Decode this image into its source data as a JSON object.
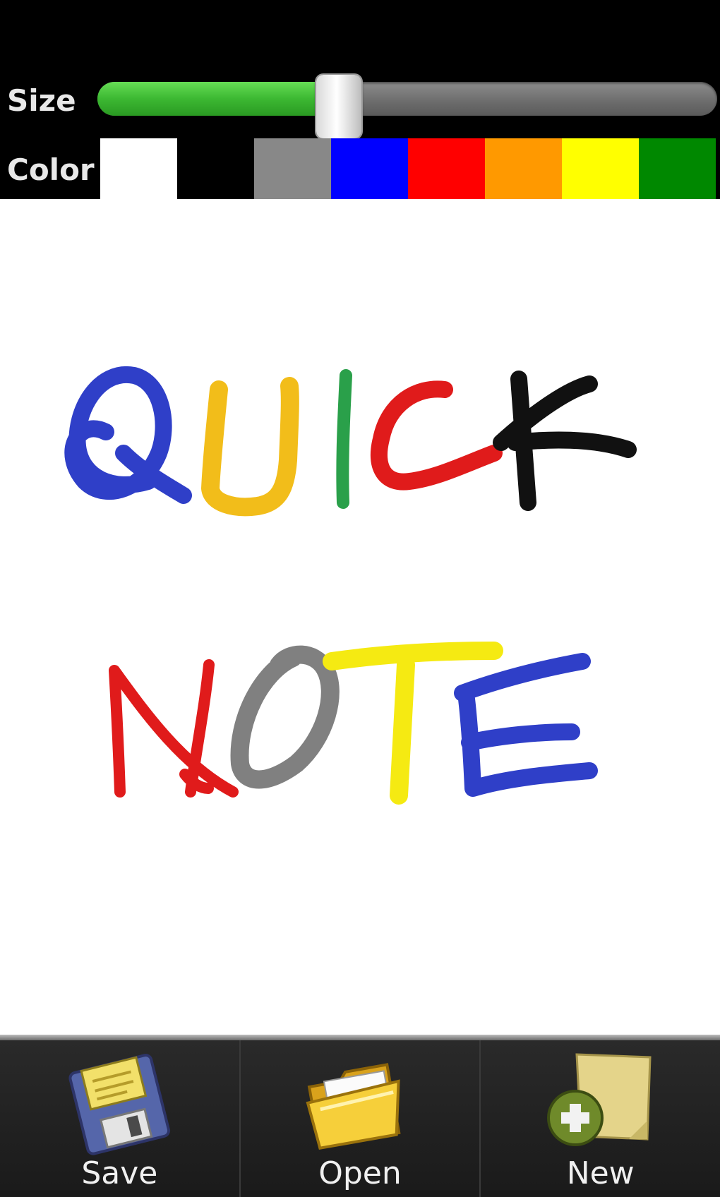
{
  "toolbar": {
    "size_label": "Size",
    "size_value": 0.39,
    "color_label": "Color",
    "colors": [
      {
        "name": "white",
        "hex": "#ffffff"
      },
      {
        "name": "black",
        "hex": "#000000"
      },
      {
        "name": "gray",
        "hex": "#888888"
      },
      {
        "name": "blue",
        "hex": "#0000ff"
      },
      {
        "name": "red",
        "hex": "#ff0000"
      },
      {
        "name": "orange",
        "hex": "#ff9900"
      },
      {
        "name": "yellow",
        "hex": "#ffff00"
      },
      {
        "name": "green",
        "hex": "#008800"
      }
    ],
    "selected_color": "white",
    "slider_fill_color": "#3cb832"
  },
  "actions": [
    {
      "id": "save",
      "label": "Save",
      "icon": "floppy-disk-icon"
    },
    {
      "id": "open",
      "label": "Open",
      "icon": "folder-icon"
    },
    {
      "id": "new",
      "label": "New",
      "icon": "new-note-icon"
    }
  ]
}
